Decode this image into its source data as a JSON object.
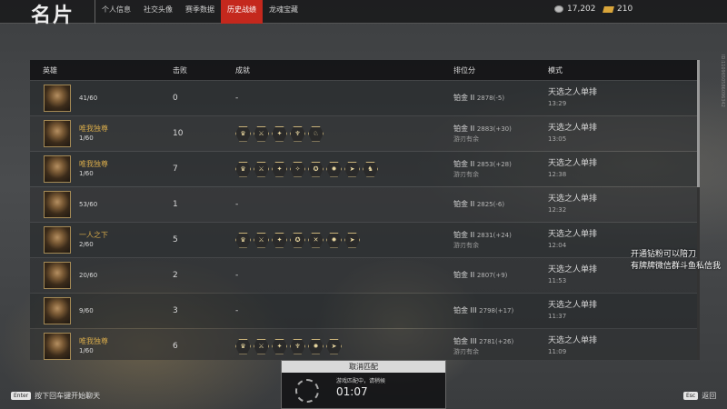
{
  "header": {
    "title": "名片",
    "tabs": [
      {
        "label": "个人信息",
        "active": false
      },
      {
        "label": "社交头像",
        "active": false
      },
      {
        "label": "赛季数据",
        "active": false
      },
      {
        "label": "历史战绩",
        "active": true
      },
      {
        "label": "龙魂宝藏",
        "active": false
      }
    ],
    "silver": "17,202",
    "gold": "210"
  },
  "watermark": "ID:1109650586096342",
  "table": {
    "headers": {
      "hero": "英雄",
      "kills": "击败",
      "achievements": "成就",
      "rank": "排位分",
      "mode": "模式"
    },
    "rows": [
      {
        "name": "",
        "count": "41/60",
        "kills": "0",
        "dash": "-",
        "badges": [],
        "tier": "铂金 II",
        "score": "2878(-5)",
        "sub": "",
        "mode": "天选之人单排",
        "time": "13:29"
      },
      {
        "name": "唯我独尊",
        "count": "1/60",
        "kills": "10",
        "dash": "",
        "badges": [
          "♛",
          "⚔",
          "✦",
          "♆",
          "♘"
        ],
        "tier": "铂金 II",
        "score": "2883(+30)",
        "sub": "游刃有余",
        "mode": "天选之人单排",
        "time": "13:05"
      },
      {
        "name": "唯我独尊",
        "count": "1/60",
        "kills": "7",
        "dash": "",
        "badges": [
          "♛",
          "⚔",
          "✦",
          "✧",
          "✪",
          "✹",
          "➤",
          "♞"
        ],
        "tier": "铂金 II",
        "score": "2853(+28)",
        "sub": "游刃有余",
        "mode": "天选之人单排",
        "time": "12:38"
      },
      {
        "name": "",
        "count": "53/60",
        "kills": "1",
        "dash": "-",
        "badges": [],
        "tier": "铂金 II",
        "score": "2825(-6)",
        "sub": "",
        "mode": "天选之人单排",
        "time": "12:32"
      },
      {
        "name": "一人之下",
        "count": "2/60",
        "kills": "5",
        "dash": "",
        "badges": [
          "♛",
          "⚔",
          "✦",
          "✪",
          "✕",
          "✹",
          "➤"
        ],
        "tier": "铂金 II",
        "score": "2831(+24)",
        "sub": "游刃有余",
        "mode": "天选之人单排",
        "time": "12:04"
      },
      {
        "name": "",
        "count": "20/60",
        "kills": "2",
        "dash": "-",
        "badges": [],
        "tier": "铂金 II",
        "score": "2807(+9)",
        "sub": "",
        "mode": "天选之人单排",
        "time": "11:53"
      },
      {
        "name": "",
        "count": "9/60",
        "kills": "3",
        "dash": "-",
        "badges": [],
        "tier": "铂金 III",
        "score": "2798(+17)",
        "sub": "",
        "mode": "天选之人单排",
        "time": "11:37"
      },
      {
        "name": "唯我独尊",
        "count": "1/60",
        "kills": "6",
        "dash": "",
        "badges": [
          "♛",
          "⚔",
          "✦",
          "♆",
          "✹",
          "➤"
        ],
        "tier": "铂金 III",
        "score": "2781(+26)",
        "sub": "游刃有余",
        "mode": "天选之人单排",
        "time": "11:09"
      }
    ]
  },
  "overlay": {
    "line1": "开通钻粉可以陪刀",
    "line2": "有牌牌微信群斗鱼私信我"
  },
  "match": {
    "header": "取消匹配",
    "status": "游戏匹配中，请稍候",
    "time": "01:07"
  },
  "footer": {
    "enter_key": "Enter",
    "enter_hint": "按下回车键开始聊天",
    "esc_key": "Esc",
    "esc_hint": "返回"
  }
}
